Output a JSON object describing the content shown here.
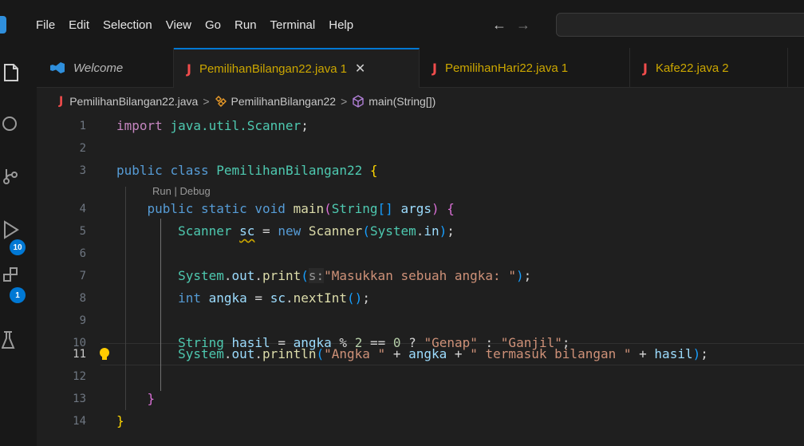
{
  "menu": {
    "items": [
      "File",
      "Edit",
      "Selection",
      "View",
      "Go",
      "Run",
      "Terminal",
      "Help"
    ]
  },
  "nav": {
    "back": "←",
    "forward": "→"
  },
  "activity": {
    "icons": [
      "explorer-icon",
      "search-icon",
      "source-control-icon",
      "run-debug-icon",
      "extensions-icon",
      "testing-icon"
    ],
    "run_badge": "10",
    "extensions_badge": "1"
  },
  "tabs": [
    {
      "label": "Welcome",
      "problems": "",
      "close": ""
    },
    {
      "label": "PemilihanBilangan22.java",
      "problems": "1",
      "close": "✕"
    },
    {
      "label": "PemilihanHari22.java",
      "problems": "1",
      "close": ""
    },
    {
      "label": "Kafe22.java",
      "problems": "2",
      "close": ""
    }
  ],
  "breadcrumb": {
    "file": "PemilihanBilangan22.java",
    "sep": ">",
    "class": "PemilihanBilangan22",
    "method": "main(String[])"
  },
  "editor": {
    "codelens": "Run | Debug",
    "line_numbers": [
      "1",
      "2",
      "3",
      "4",
      "5",
      "6",
      "7",
      "8",
      "9",
      "10",
      "11",
      "12",
      "13",
      "14"
    ],
    "current_line": "11",
    "tokens": {
      "l1_import": "import",
      "l1_pkg": "java.util.Scanner",
      "l1_semi": ";",
      "l3_public": "public",
      "l3_class": "class",
      "l3_name": "PemilihanBilangan22",
      "l3_brace": "{",
      "l4_public": "public",
      "l4_static": "static",
      "l4_void": "void",
      "l4_main": "main",
      "l4_paren_open": "(",
      "l4_string": "String",
      "l4_arr": "[]",
      "l4_args": "args",
      "l4_paren_close": ")",
      "l4_brace": "{",
      "l5_scanner": "Scanner",
      "l5_sc": "sc",
      "l5_eq": "=",
      "l5_new": "new",
      "l5_scanner2": "Scanner",
      "l5_open": "(",
      "l5_system": "System",
      "l5_in": "in",
      "l5_close": ")",
      "l5_semi": ";",
      "l7_system": "System",
      "l7_out": "out",
      "l7_print": "print",
      "l7_open": "(",
      "l7_hint": "s:",
      "l7_str": "\"Masukkan sebuah angka: \"",
      "l7_close": ")",
      "l7_semi": ";",
      "l8_int": "int",
      "l8_angka": "angka",
      "l8_eq": "=",
      "l8_sc": "sc",
      "l8_next": "nextInt",
      "l8_parens": "()",
      "l8_semi": ";",
      "l10_string": "String",
      "l10_hasil": "hasil",
      "l10_eq": "=",
      "l10_angka": "angka",
      "l10_mod": "%",
      "l10_two": "2",
      "l10_eqeq": "==",
      "l10_zero": "0",
      "l10_q": "?",
      "l10_genap": "\"Genap\"",
      "l10_colon": ":",
      "l10_ganjil": "\"Ganjil\"",
      "l10_semi": ";",
      "l11_system": "System",
      "l11_out": "out",
      "l11_println": "println",
      "l11_open": "(",
      "l11_str1": "\"Angka \"",
      "l11_plus1": "+",
      "l11_angka": "angka",
      "l11_plus2": "+",
      "l11_str2": "\" termasuk bilangan \"",
      "l11_plus3": "+",
      "l11_hasil": "hasil",
      "l11_close": ")",
      "l11_semi": ";",
      "l13_brace": "}",
      "l14_brace": "}"
    }
  }
}
